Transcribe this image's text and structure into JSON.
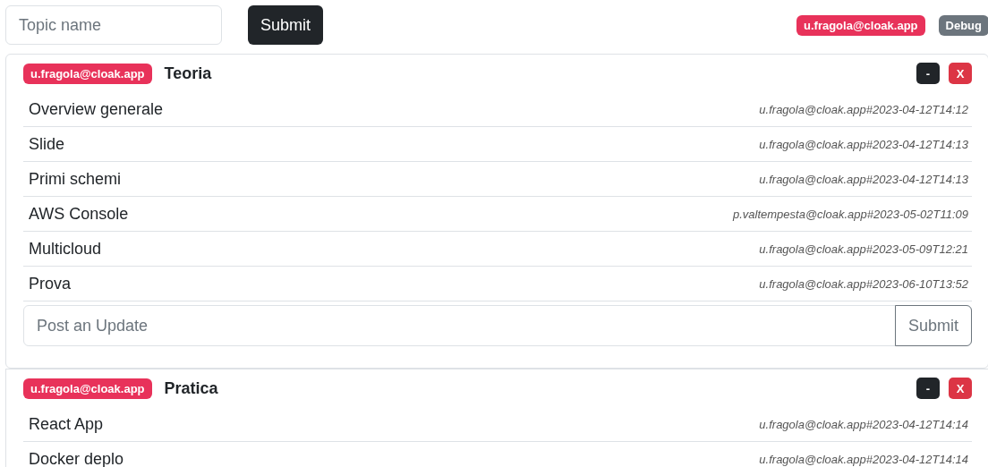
{
  "topbar": {
    "topic_field": {
      "placeholder": "Topic name"
    },
    "submit": "Submit",
    "user_badge": "u.fragola@cloak.app",
    "debug": "Debug"
  },
  "topics": [
    {
      "author": "u.fragola@cloak.app",
      "title": "Teoria",
      "collapse": "-",
      "delete": "X",
      "updates": [
        {
          "text": "Overview generale",
          "meta": "u.fragola@cloak.app#2023-04-12T14:12"
        },
        {
          "text": "Slide",
          "meta": "u.fragola@cloak.app#2023-04-12T14:13"
        },
        {
          "text": "Primi schemi",
          "meta": "u.fragola@cloak.app#2023-04-12T14:13"
        },
        {
          "text": "AWS Console",
          "meta": "p.valtempesta@cloak.app#2023-05-02T11:09"
        },
        {
          "text": "Multicloud",
          "meta": "u.fragola@cloak.app#2023-05-09T12:21"
        },
        {
          "text": "Prova",
          "meta": "u.fragola@cloak.app#2023-06-10T13:52"
        }
      ],
      "post": {
        "placeholder": "Post an Update",
        "submit": "Submit"
      }
    },
    {
      "author": "u.fragola@cloak.app",
      "title": "Pratica",
      "collapse": "-",
      "delete": "X",
      "updates": [
        {
          "text": "React App",
          "meta": "u.fragola@cloak.app#2023-04-12T14:14"
        },
        {
          "text": "Docker deplo",
          "meta": "u.fragola@cloak.app#2023-04-12T14:14"
        }
      ]
    }
  ]
}
